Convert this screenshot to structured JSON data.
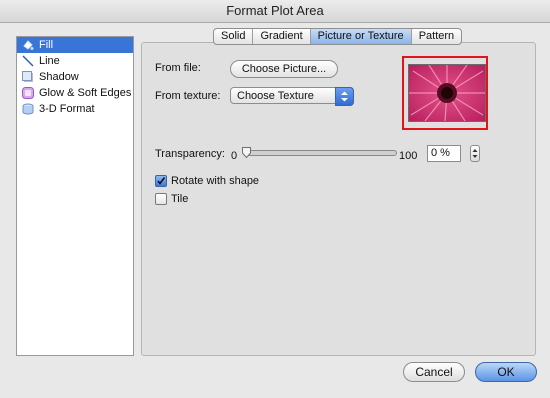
{
  "window": {
    "title": "Format Plot Area"
  },
  "sidebar": {
    "items": [
      {
        "label": "Fill",
        "icon": "fill-bucket-icon",
        "selected": true
      },
      {
        "label": "Line",
        "icon": "line-icon",
        "selected": false
      },
      {
        "label": "Shadow",
        "icon": "shadow-icon",
        "selected": false
      },
      {
        "label": "Glow & Soft Edges",
        "icon": "glow-icon",
        "selected": false
      },
      {
        "label": "3-D Format",
        "icon": "3d-format-icon",
        "selected": false
      }
    ]
  },
  "tabs": [
    {
      "label": "Solid",
      "active": false
    },
    {
      "label": "Gradient",
      "active": false
    },
    {
      "label": "Picture or Texture",
      "active": true
    },
    {
      "label": "Pattern",
      "active": false
    }
  ],
  "fill": {
    "from_file_label": "From file:",
    "choose_picture_label": "Choose Picture...",
    "from_texture_label": "From texture:",
    "texture_select_value": "Choose Texture",
    "preview_image": "pink-gerbera-flower"
  },
  "transparency": {
    "label": "Transparency:",
    "min_label": "0",
    "max_label": "100",
    "value": "0 %",
    "level": 0
  },
  "options": {
    "rotate_with_shape": {
      "label": "Rotate with shape",
      "checked": true
    },
    "tile": {
      "label": "Tile",
      "checked": false
    }
  },
  "buttons": {
    "cancel": "Cancel",
    "ok": "OK"
  },
  "colors": {
    "accent": "#3875d7",
    "highlight_border": "#e0141a"
  }
}
